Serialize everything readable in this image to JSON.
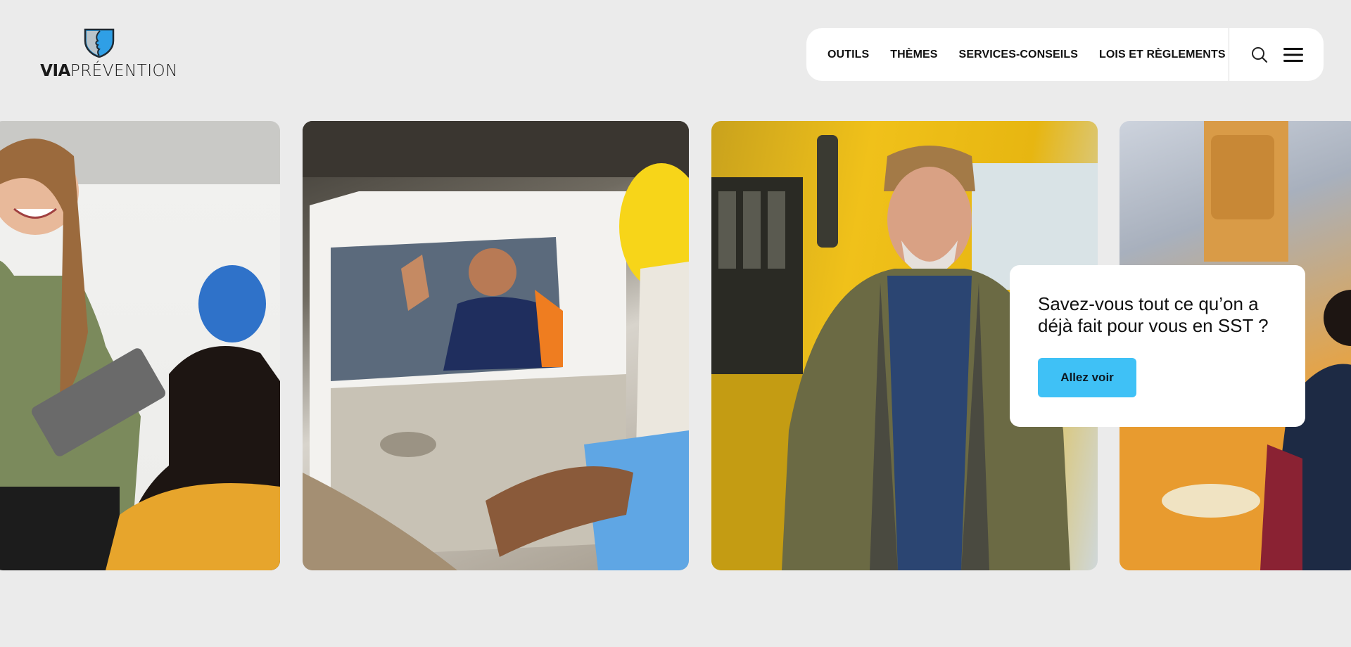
{
  "brand": {
    "logo_bold": "VIA",
    "logo_light": "PRÉVENTION",
    "colors": {
      "shield_blue": "#2f9fe6",
      "shield_dark": "#1f2a33",
      "accent": "#3fc1f6"
    }
  },
  "nav": {
    "items": [
      {
        "label": "OUTILS"
      },
      {
        "label": "THÈMES"
      },
      {
        "label": "SERVICES-CONSEILS"
      },
      {
        "label": "LOIS ET RÈGLEMENTS"
      }
    ],
    "icons": [
      "search-icon",
      "menu-icon"
    ]
  },
  "promo": {
    "text": "Savez-vous tout ce qu’on a déjà fait pour vous en SST ?",
    "button_label": "Allez voir"
  }
}
